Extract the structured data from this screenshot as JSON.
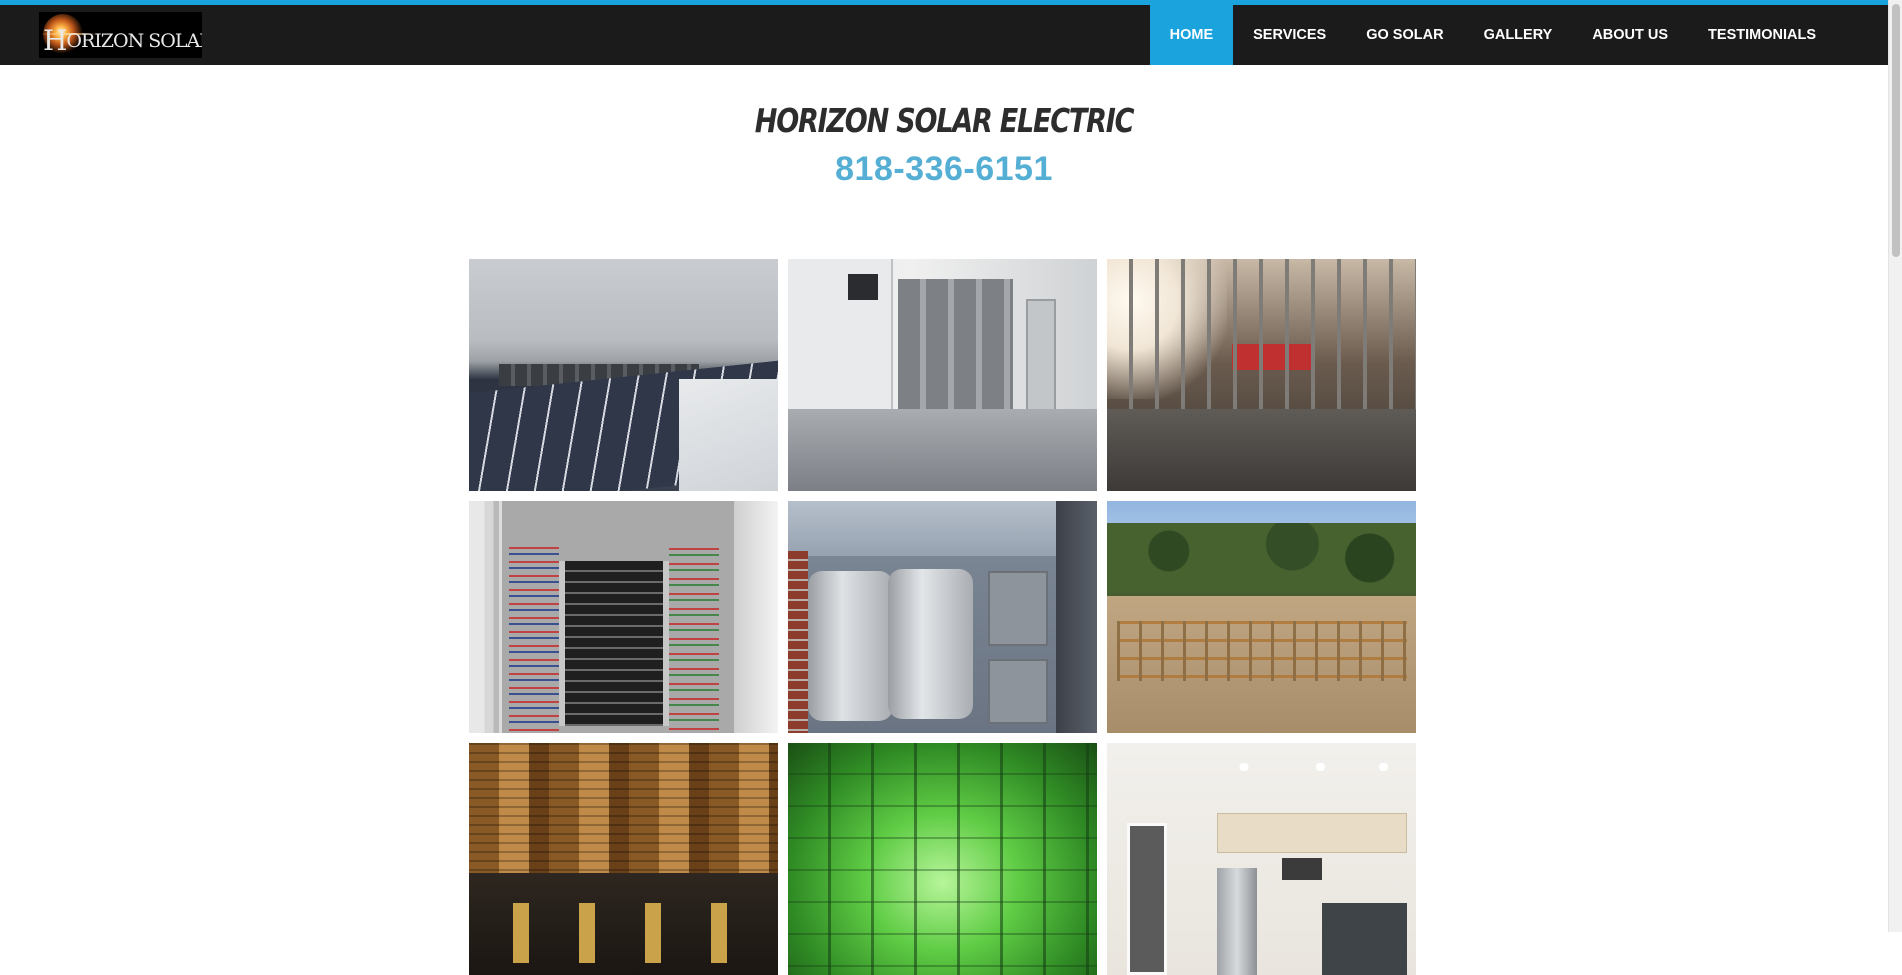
{
  "logo": {
    "text_lead": "H",
    "text_rest": "ORIZON SOLAR ELECTRIC"
  },
  "nav": {
    "items": [
      {
        "label": "HOME",
        "active": true
      },
      {
        "label": "SERVICES",
        "active": false
      },
      {
        "label": "GO SOLAR",
        "active": false
      },
      {
        "label": "GALLERY",
        "active": false
      },
      {
        "label": "ABOUT US",
        "active": false
      },
      {
        "label": "TESTIMONIALS",
        "active": false
      }
    ]
  },
  "hero": {
    "title": "HORIZON SOLAR ELECTRIC",
    "phone": "818-336-6151"
  },
  "gallery": {
    "photos": [
      {
        "name": "rooftop-solar-photo"
      },
      {
        "name": "electrical-room-photo"
      },
      {
        "name": "framing-interior-photo"
      },
      {
        "name": "breaker-panel-photo"
      },
      {
        "name": "battery-storage-photo"
      },
      {
        "name": "construction-site-photo"
      },
      {
        "name": "transformer-photo"
      },
      {
        "name": "grow-room-photo"
      },
      {
        "name": "kitchen-remodel-photo"
      }
    ]
  },
  "colors": {
    "accent": "#1aa3dc",
    "navbar": "#1b1b1b",
    "phone": "#55aed3",
    "title": "#2d2d2d"
  }
}
